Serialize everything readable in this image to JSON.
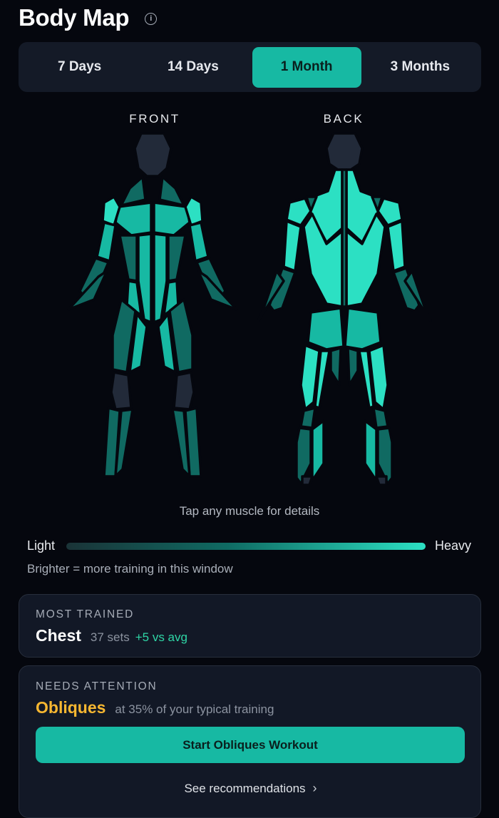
{
  "header": {
    "title": "Body Map",
    "info_icon": "info-circle-icon"
  },
  "range_tabs": [
    {
      "label": "7 Days",
      "active": false
    },
    {
      "label": "14 Days",
      "active": false
    },
    {
      "label": "1 Month",
      "active": true
    },
    {
      "label": "3 Months",
      "active": false
    }
  ],
  "body_map": {
    "front_label": "FRONT",
    "back_label": "BACK",
    "hint": "Tap any muscle for details",
    "colors": {
      "none": "#222a39",
      "light": "#106a62",
      "medium": "#17b9a3",
      "heavy": "#2ce0c3",
      "outline": "#05070e"
    }
  },
  "legend": {
    "light_label": "Light",
    "heavy_label": "Heavy",
    "note": "Brighter = more training in this window",
    "gradient": [
      "#1a3337",
      "#0f6b63",
      "#2ce0c3"
    ]
  },
  "most_trained": {
    "eyebrow": "MOST TRAINED",
    "muscle": "Chest",
    "sets": "37 sets",
    "delta": "+5 vs avg"
  },
  "needs_attention": {
    "eyebrow": "NEEDS ATTENTION",
    "muscle": "Obliques",
    "detail": "at 35% of your typical training",
    "cta_label": "Start Obliques Workout",
    "link_label": "See recommendations",
    "link_icon": "chevron-right-icon",
    "accent": "#f7b731"
  }
}
